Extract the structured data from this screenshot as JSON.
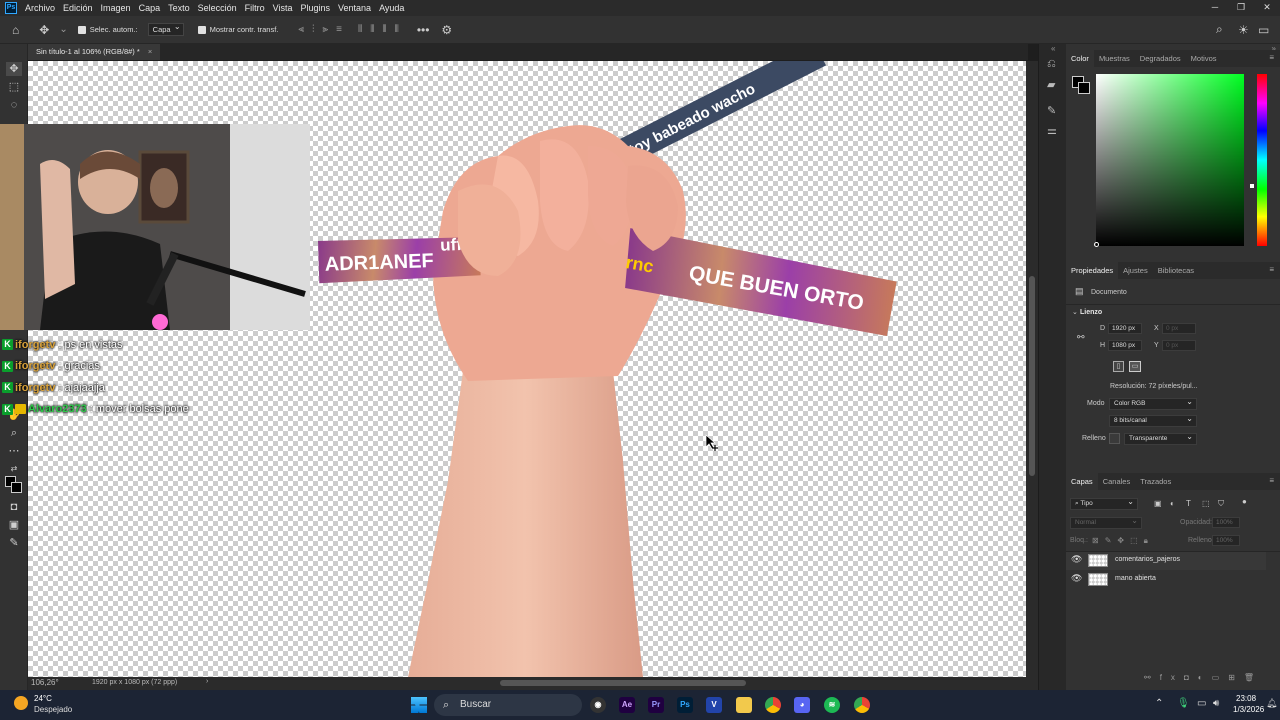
{
  "menubar": {
    "items": [
      "Archivo",
      "Edición",
      "Imagen",
      "Capa",
      "Texto",
      "Selección",
      "Filtro",
      "Vista",
      "Plugins",
      "Ventana",
      "Ayuda"
    ]
  },
  "options": {
    "auto_select_label": "Selec. autom.:",
    "auto_select_value": "Capa",
    "show_transform_label": "Mostrar contr. transf."
  },
  "document": {
    "tab_title": "Sin título-1 al 106% (RGB/8#) *",
    "zoom": "106,26°",
    "dimensions": "1920 px x 1080 px (72 ppp)"
  },
  "canvas_art": {
    "strip1_text_left": "ADR1ANEF",
    "strip1_text_mid": "uffff",
    "strip1_text_right": "rnc",
    "strip1_text_main": "QUE BUEN ORTO",
    "strip2_text": "estoy babeado wacho"
  },
  "chat": [
    {
      "user": "iforgetv",
      "text": ": ps en vistas",
      "user_color": "#d9a23a"
    },
    {
      "user": "iforgetv",
      "text": ": gracias",
      "user_color": "#d9a23a"
    },
    {
      "user": "iforgetv",
      "text": ": ajajaajja",
      "user_color": "#d9a23a"
    },
    {
      "user": "Alvaro2373",
      "text": ": mover bolsas pone",
      "user_color": "#2ec84a"
    }
  ],
  "color_panel": {
    "tabs": [
      "Color",
      "Muestras",
      "Degradados",
      "Motivos"
    ]
  },
  "properties": {
    "tabs": [
      "Propiedades",
      "Ajustes",
      "Bibliotecas"
    ],
    "doc_label": "Documento",
    "section": "Lienzo",
    "w_label": "D",
    "w_value": "1920 px",
    "h_label": "H",
    "h_value": "1080 px",
    "x_label": "X",
    "x_value": "0 px",
    "y_label": "Y",
    "y_value": "0 px",
    "resolution": "Resolución: 72 píxeles/pul...",
    "mode_label": "Modo",
    "mode_value": "Color RGB",
    "bits_value": "8 bits/canal",
    "fill_label": "Relleno",
    "fill_value": "Transparente"
  },
  "layers_panel": {
    "tabs": [
      "Capas",
      "Canales",
      "Trazados"
    ],
    "filter_value": "Tipo",
    "blend_mode": "Normal",
    "opacity_label": "Opacidad:",
    "opacity_value": "100%",
    "lock_label": "Bloq.:",
    "fill_label": "Relleno:",
    "fill_value": "100%",
    "layers": [
      {
        "name": "comentarios_pajeros"
      },
      {
        "name": "mano abierta"
      }
    ]
  },
  "taskbar": {
    "weather_temp": "24°C",
    "weather_desc": "Despejado",
    "search_placeholder": "Buscar",
    "time": "23:08",
    "date": "1/3/2026"
  }
}
